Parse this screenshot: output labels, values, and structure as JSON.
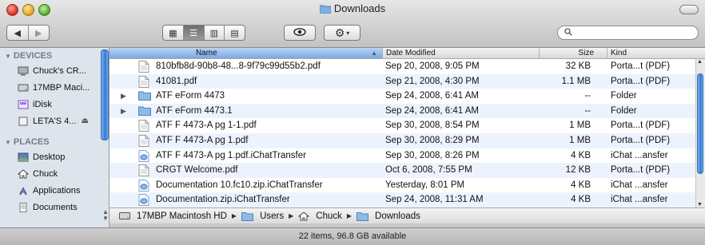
{
  "window": {
    "title": "Downloads",
    "folder_icon": "folder-icon"
  },
  "toolbar": {
    "back_icon": "back-arrow-icon",
    "forward_icon": "forward-arrow-icon",
    "view_modes": [
      {
        "name": "icon-view-icon",
        "glyph": "▦"
      },
      {
        "name": "list-view-icon",
        "glyph": "☰",
        "selected": true
      },
      {
        "name": "column-view-icon",
        "glyph": "▥"
      },
      {
        "name": "coverflow-view-icon",
        "glyph": "▤"
      }
    ],
    "quicklook_icon": "eye-icon",
    "action_icon": "gear-icon",
    "search": {
      "value": "",
      "placeholder": ""
    }
  },
  "sidebar": {
    "devices_header": "DEVICES",
    "devices": [
      {
        "label": "Chuck's CR...",
        "icon": "computer-icon"
      },
      {
        "label": "17MBP Maci...",
        "icon": "hard-drive-icon"
      },
      {
        "label": "iDisk",
        "icon": "idisk-icon"
      },
      {
        "label": "LETA'S 4...",
        "icon": "external-drive-icon",
        "eject": "⏏"
      }
    ],
    "places_header": "PLACES",
    "places": [
      {
        "label": "Desktop",
        "icon": "desktop-icon"
      },
      {
        "label": "Chuck",
        "icon": "home-icon"
      },
      {
        "label": "Applications",
        "icon": "applications-icon"
      },
      {
        "label": "Documents",
        "icon": "documents-icon"
      }
    ]
  },
  "columns": {
    "name": "Name",
    "date": "Date Modified",
    "size": "Size",
    "kind": "Kind"
  },
  "files": [
    {
      "name": "810bfb8d-90b8-48...8-9f79c99d55b2.pdf",
      "date": "Sep 20, 2008, 9:05 PM",
      "size": "32 KB",
      "kind": "Porta...t (PDF)",
      "type": "pdf",
      "folder": false
    },
    {
      "name": "41081.pdf",
      "date": "Sep 21, 2008, 4:30 PM",
      "size": "1.1 MB",
      "kind": "Porta...t (PDF)",
      "type": "pdf",
      "folder": false
    },
    {
      "name": "ATF eForm 4473",
      "date": "Sep 24, 2008, 6:41 AM",
      "size": "--",
      "kind": "Folder",
      "type": "folder",
      "folder": true
    },
    {
      "name": "ATF eForm 4473.1",
      "date": "Sep 24, 2008, 6:41 AM",
      "size": "--",
      "kind": "Folder",
      "type": "folder",
      "folder": true
    },
    {
      "name": "ATF F 4473-A pg 1-1.pdf",
      "date": "Sep 30, 2008, 8:54 PM",
      "size": "1 MB",
      "kind": "Porta...t (PDF)",
      "type": "pdf",
      "folder": false
    },
    {
      "name": "ATF F 4473-A pg 1.pdf",
      "date": "Sep 30, 2008, 8:29 PM",
      "size": "1 MB",
      "kind": "Porta...t (PDF)",
      "type": "pdf",
      "folder": false
    },
    {
      "name": "ATF F 4473-A pg 1.pdf.iChatTransfer",
      "date": "Sep 30, 2008, 8:26 PM",
      "size": "4 KB",
      "kind": "iChat ...ansfer",
      "type": "ichat",
      "folder": false
    },
    {
      "name": "CRGT Welcome.pdf",
      "date": "Oct 6, 2008, 7:55 PM",
      "size": "12 KB",
      "kind": "Porta...t (PDF)",
      "type": "pdf",
      "folder": false
    },
    {
      "name": "Documentation 10.fc10.zip.iChatTransfer",
      "date": "Yesterday, 8:01 PM",
      "size": "4 KB",
      "kind": "iChat ...ansfer",
      "type": "ichat",
      "folder": false
    },
    {
      "name": "Documentation.zip.iChatTransfer",
      "date": "Sep 24, 2008, 11:31 AM",
      "size": "4 KB",
      "kind": "iChat ...ansfer",
      "type": "ichat",
      "folder": false
    }
  ],
  "path": [
    {
      "label": "17MBP Macintosh HD",
      "icon": "hard-drive-icon"
    },
    {
      "label": "Users",
      "icon": "folder-icon"
    },
    {
      "label": "Chuck",
      "icon": "home-icon"
    },
    {
      "label": "Downloads",
      "icon": "folder-icon"
    }
  ],
  "status": "22 items, 96.8 GB available",
  "colors": {
    "selection_blue": "#7aa9e4",
    "stripe": "#edf3fe",
    "sidebar": "#dde4ec"
  }
}
